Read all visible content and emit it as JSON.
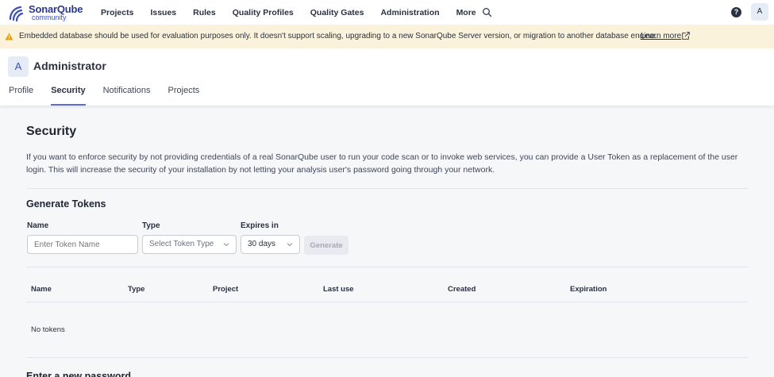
{
  "topnav": {
    "logo_name": "SonarQube",
    "logo_sub": "community",
    "items": [
      "Projects",
      "Issues",
      "Rules",
      "Quality Profiles",
      "Quality Gates",
      "Administration",
      "More"
    ],
    "help_glyph": "?",
    "avatar_letter": "A"
  },
  "banner": {
    "text": "Embedded database should be used for evaluation purposes only. It doesn't support scaling, upgrading to a new SonarQube Server version, or migration to another database engine.",
    "link": "Learn more"
  },
  "account": {
    "avatar_letter": "A",
    "name": "Administrator",
    "tabs": [
      "Profile",
      "Security",
      "Notifications",
      "Projects"
    ],
    "active_tab": "Security"
  },
  "security": {
    "title": "Security",
    "description": "If you want to enforce security by not providing credentials of a real SonarQube user to run your code scan or to invoke web services, you can provide a User Token as a replacement of the user login. This will increase the security of your installation by not letting your analysis user's password going through your network."
  },
  "generate": {
    "title": "Generate Tokens",
    "name_label": "Name",
    "name_placeholder": "Enter Token Name",
    "type_label": "Type",
    "type_placeholder": "Select Token Type",
    "expires_label": "Expires in",
    "expires_value": "30 days",
    "button": "Generate"
  },
  "tokens_table": {
    "columns": [
      "Name",
      "Type",
      "Project",
      "Last use",
      "Created",
      "Expiration"
    ],
    "empty_text": "No tokens"
  },
  "password": {
    "title": "Enter a new password"
  },
  "colors": {
    "accent": "#5d6cd0",
    "banner_bg": "#fbf2dc",
    "warning": "#e0a21a"
  }
}
